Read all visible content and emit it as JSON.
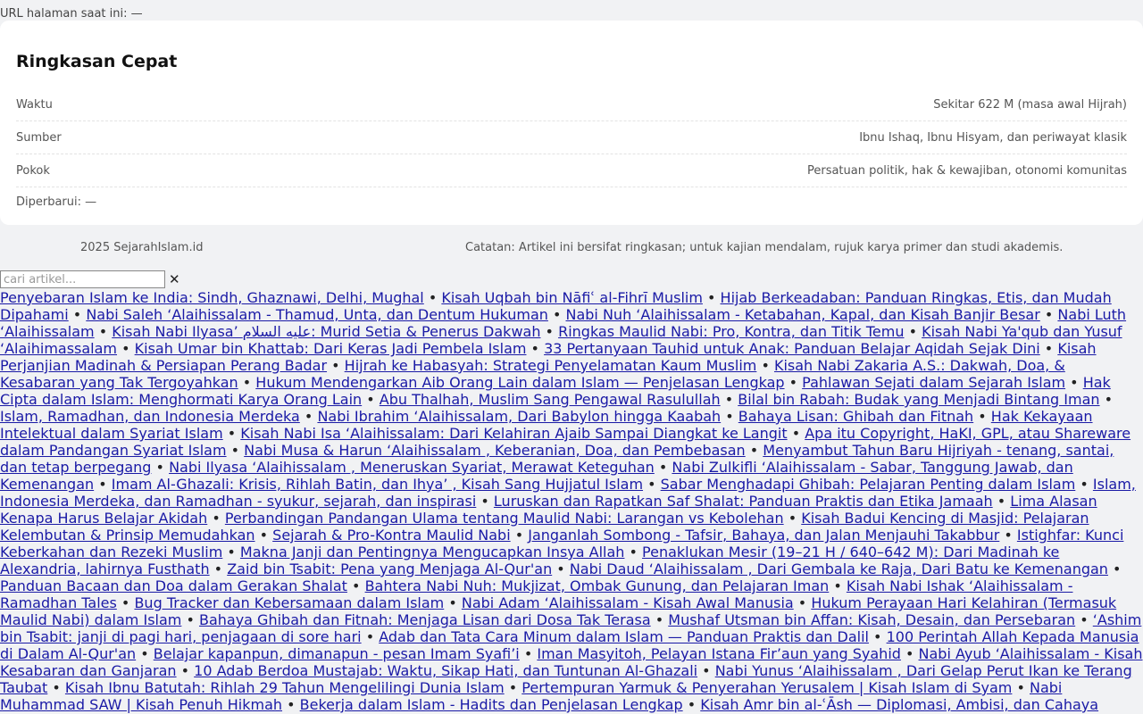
{
  "page_url": {
    "label": "URL halaman saat ini: —"
  },
  "summary": {
    "title": "Ringkasan Cepat",
    "rows": [
      {
        "label": "Waktu",
        "value": "Sekitar 622 M (masa awal Hijrah)"
      },
      {
        "label": "Sumber",
        "value": "Ibnu Ishaq, Ibnu Hisyam, dan periwayat klasik"
      },
      {
        "label": "Pokok",
        "value": "Persatuan politik, hak & kewajiban, otonomi komunitas"
      }
    ],
    "updated": "Diperbarui: —"
  },
  "footer": {
    "copyright": " 2025 SejarahIslam.id",
    "note": "Catatan: Artikel ini bersifat ringkasan; untuk kajian mendalam, rujuk karya primer dan studi akademis."
  },
  "search": {
    "placeholder": "cari artikel...",
    "clear_label": "✕"
  },
  "separator": " • ",
  "articles": [
    "Penyebaran Islam ke India: Sindh, Ghaznawi, Delhi, Mughal",
    "Kisah Uqbah bin Nāfiʿ al-Fihrī Muslim",
    "Hijab Berkeadaban: Panduan Ringkas, Etis, dan Mudah Dipahami",
    "Nabi Saleh ‘Alaihissalam - Thamud, Unta, dan Dentum Hukuman",
    "Nabi Nuh ‘Alaihissalam - Ketabahan, Kapal, dan Kisah Banjir Besar",
    "Nabi Luth ‘Alaihissalam",
    "Kisah Nabi Ilyasa’ عليه السلام: Murid Setia & Penerus Dakwah",
    "Ringkas Maulid Nabi: Pro, Kontra, dan Titik Temu",
    "Kisah Nabi Ya'qub dan Yusuf ‘Alaihimassalam",
    "Kisah Umar bin Khattab: Dari Keras Jadi Pembela Islam",
    "33 Pertanyaan Tauhid untuk Anak: Panduan Belajar Aqidah Sejak Dini",
    "Kisah Perjanjian Madinah & Persiapan Perang Badar",
    "Hijrah ke Habasyah: Strategi Penyelamatan Kaum Muslim",
    "Kisah Nabi Zakaria A.S.: Dakwah, Doa, & Kesabaran yang Tak Tergoyahkan",
    "Hukum Mendengarkan Aib Orang Lain dalam Islam — Penjelasan Lengkap",
    "Pahlawan Sejati dalam Sejarah Islam",
    "Hak Cipta dalam Islam: Menghormati Karya Orang Lain",
    "Abu Thalhah, Muslim Sang Pengawal Rasulullah",
    "Bilal bin Rabah: Budak yang Menjadi Bintang Iman",
    "Islam, Ramadhan, dan Indonesia Merdeka",
    "Nabi Ibrahim ‘Alaihissalam, Dari Babylon hingga Kaabah",
    "Bahaya Lisan: Ghibah dan Fitnah",
    "Hak Kekayaan Intelektual dalam Syariat Islam",
    "Kisah Nabi Isa ‘Alaihissalam: Dari Kelahiran Ajaib Sampai Diangkat ke Langit",
    "Apa itu Copyright, HaKI, GPL, atau Shareware dalam Pandangan Syariat Islam",
    "Nabi Musa & Harun ‘Alaihissalam , Keberanian, Doa, dan Pembebasan",
    "Menyambut Tahun Baru Hijriyah - tenang, santai, dan tetap berpegang",
    "Nabi Ilyasa ‘Alaihissalam , Meneruskan Syariat, Merawat Keteguhan",
    "Nabi Zulkifli ‘Alaihissalam - Sabar, Tanggung Jawab, dan Kemenangan",
    "Imam Al-Ghazali: Krisis, Rihlah Batin, dan Ihya’ , Kisah Sang Hujjatul Islam",
    "Sabar Menghadapi Ghibah: Pelajaran Penting dalam Islam",
    "Islam, Indonesia Merdeka, dan Ramadhan - syukur, sejarah, dan inspirasi",
    "Luruskan dan Rapatkan Saf Shalat: Panduan Praktis dan Etika Jamaah",
    "Lima Alasan Kenapa Harus Belajar Akidah",
    "Perbandingan Pandangan Ulama tentang Maulid Nabi: Larangan vs Kebolehan",
    "Kisah Badui Kencing di Masjid: Pelajaran Kelembutan & Prinsip Memudahkan",
    "Sejarah & Pro-Kontra Maulid Nabi",
    "Janganlah Sombong - Tafsir, Bahaya, dan Jalan Menjauhi Takabbur",
    "Istighfar: Kunci Keberkahan dan Rezeki Muslim",
    "Makna Janji dan Pentingnya Mengucapkan Insya Allah",
    "Penaklukan Mesir (19–21 H / 640–642 M): Dari Madinah ke Alexandria, lahirnya Fusthath",
    "Zaid bin Tsabit: Pena yang Menjaga Al-Qur'an",
    "Nabi Daud ‘Alaihissalam , Dari Gembala ke Raja, Dari Batu ke Kemenangan",
    "Panduan Bacaan dan Doa dalam Gerakan Shalat",
    "Bahtera Nabi Nuh: Mukjizat, Ombak Gunung, dan Pelajaran Iman",
    "Kisah Nabi Ishak ‘Alaihissalam - Ramadhan Tales",
    "Bug Tracker dan Kebersamaan dalam Islam",
    "Nabi Adam ‘Alaihissalam - Kisah Awal Manusia",
    "Hukum Perayaan Hari Kelahiran (Termasuk Maulid Nabi) dalam Islam",
    "Bahaya Ghibah dan Fitnah: Menjaga Lisan dari Dosa Tak Terasa",
    "Mushaf Utsman bin Affan: Kisah, Desain, dan Persebaran",
    "‘Ashim bin Tsabit: janji di pagi hari, penjagaan di sore hari",
    "Adab dan Tata Cara Minum dalam Islam — Panduan Praktis dan Dalil",
    "100 Perintah Allah Kepada Manusia di Dalam Al-Qur'an",
    "Belajar kapanpun, dimanapun - pesan Imam Syafi’i",
    "Iman Masyitoh, Pelayan Istana Fir’aun yang Syahid",
    "Nabi Ayub ‘Alaihissalam - Kisah Kesabaran dan Ganjaran",
    "10 Adab Berdoa Mustajab: Waktu, Sikap Hati, dan Tuntunan Al-Ghazali",
    "Nabi Yunus ‘Alaihissalam , Dari Gelap Perut Ikan ke Terang Taubat",
    "Kisah Ibnu Batutah: Rihlah 29 Tahun Mengelilingi Dunia Islam",
    "Pertempuran Yarmuk & Penyerahan Yerusalem | Kisah Islam di Syam",
    "Nabi Muhammad SAW | Kisah Penuh Hikmah",
    "Bekerja dalam Islam - Hadits dan Penjelasan Lengkap",
    "Kisah Amr bin al-ʿĀsh — Diplomasi, Ambisi, dan Cahaya"
  ]
}
